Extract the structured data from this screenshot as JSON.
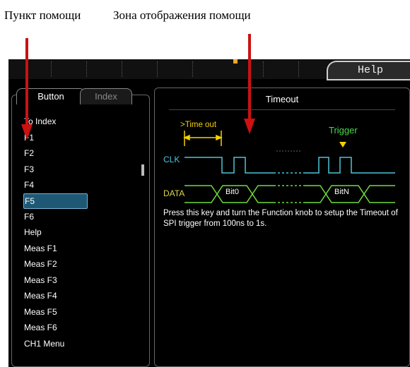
{
  "callouts": {
    "help_item": "Пункт помощи",
    "help_display_area": "Зона отображения помощи"
  },
  "top_bar": {
    "help_tab_label": "Help"
  },
  "left_panel": {
    "tabs": [
      {
        "label": "Button",
        "active": true
      },
      {
        "label": "Index",
        "active": false
      }
    ],
    "items": [
      {
        "label": "To Index"
      },
      {
        "label": "F1"
      },
      {
        "label": "F2"
      },
      {
        "label": "F3"
      },
      {
        "label": "F4"
      },
      {
        "label": "F5",
        "selected": true
      },
      {
        "label": "F6"
      },
      {
        "label": "Help"
      },
      {
        "label": "Meas F1"
      },
      {
        "label": "Meas F2"
      },
      {
        "label": "Meas F3"
      },
      {
        "label": "Meas F4"
      },
      {
        "label": "Meas F5"
      },
      {
        "label": "Meas F6"
      },
      {
        "label": "CH1 Menu"
      }
    ]
  },
  "right_panel": {
    "title": "Timeout",
    "diagram": {
      "timeout_label": ">Time out",
      "trigger_label": "Trigger",
      "clk_label": "CLK",
      "data_label": "DATA",
      "bit0_label": "Bit0",
      "bitn_label": "BitN"
    },
    "description": "Press this key and turn the Function knob to setup the Timeout of SPI trigger from 100ns to 1s."
  },
  "colors": {
    "callout_arrow": "#cc1111",
    "clk_wave": "#4cc6da",
    "data_wave": "#6fdc3c",
    "timeout": "#f4d100",
    "trigger": "#4cd84c",
    "selected_item_bg": "#1f5874"
  }
}
